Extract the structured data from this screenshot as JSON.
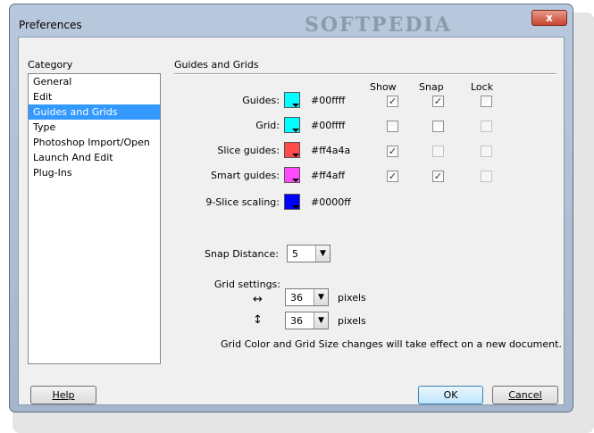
{
  "window": {
    "title": "Preferences",
    "watermark": "SOFTPEDIA",
    "close_glyph": "x"
  },
  "category": {
    "label": "Category",
    "items": [
      "General",
      "Edit",
      "Guides and Grids",
      "Type",
      "Photoshop Import/Open",
      "Launch And Edit",
      "Plug-Ins"
    ],
    "selected_index": 2
  },
  "section_title": "Guides and Grids",
  "columns": {
    "show": "Show",
    "snap": "Snap",
    "lock": "Lock"
  },
  "rows": [
    {
      "label": "Guides:",
      "color": "#00ffff",
      "hex": "#00ffff",
      "show": true,
      "snap": true,
      "lock": false,
      "show_enabled": true,
      "snap_enabled": true,
      "lock_enabled": true
    },
    {
      "label": "Grid:",
      "color": "#00ffff",
      "hex": "#00ffff",
      "show": false,
      "snap": false,
      "lock": false,
      "show_enabled": true,
      "snap_enabled": true,
      "lock_enabled": false
    },
    {
      "label": "Slice guides:",
      "color": "#ff4a4a",
      "hex": "#ff4a4a",
      "show": true,
      "snap": false,
      "lock": false,
      "show_enabled": true,
      "snap_enabled": false,
      "lock_enabled": false
    },
    {
      "label": "Smart guides:",
      "color": "#ff4aff",
      "hex": "#ff4aff",
      "show": true,
      "snap": true,
      "lock": false,
      "show_enabled": true,
      "snap_enabled": true,
      "lock_enabled": false
    },
    {
      "label": "9-Slice scaling:",
      "color": "#0000ff",
      "hex": "#0000ff"
    }
  ],
  "snap_distance": {
    "label": "Snap Distance:",
    "value": "5"
  },
  "grid_settings": {
    "label": "Grid settings:",
    "horizontal": {
      "icon": "↔",
      "value": "36",
      "unit": "pixels"
    },
    "vertical": {
      "icon": "↕",
      "value": "36",
      "unit": "pixels"
    }
  },
  "note": "Grid Color and Grid Size changes will take effect on a new document.",
  "buttons": {
    "help": "Help",
    "ok": "OK",
    "cancel": "Cancel"
  },
  "check_glyph": "✓"
}
